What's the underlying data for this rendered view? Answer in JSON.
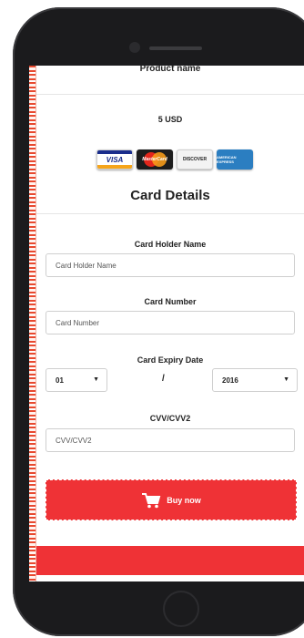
{
  "page": {
    "product_name": "Product name",
    "price": "5 USD",
    "section_title": "Card Details"
  },
  "card_brands": [
    {
      "name": "visa-card-icon",
      "label": "VISA"
    },
    {
      "name": "mastercard-icon",
      "label": "MasterCard"
    },
    {
      "name": "discover-card-icon",
      "label": "DISCOVER"
    },
    {
      "name": "amex-card-icon",
      "label": "AMERICAN EXPRESS"
    }
  ],
  "form": {
    "holder_label": "Card Holder Name",
    "holder_placeholder": "Card Holder Name",
    "number_label": "Card Number",
    "number_placeholder": "Card Number",
    "expiry_label": "Card Expiry Date",
    "expiry_month": "01",
    "expiry_separator": "/",
    "expiry_year": "2016",
    "cvv_label": "CVV/CVV2",
    "cvv_placeholder": "CVV/CVV2"
  },
  "actions": {
    "buy_label": "Buy now"
  },
  "colors": {
    "accent": "#ef3236",
    "phone_frame": "#1b1b1d"
  },
  "icons": {
    "dropdown": "chevron-down-icon",
    "cart": "shopping-cart-icon"
  }
}
